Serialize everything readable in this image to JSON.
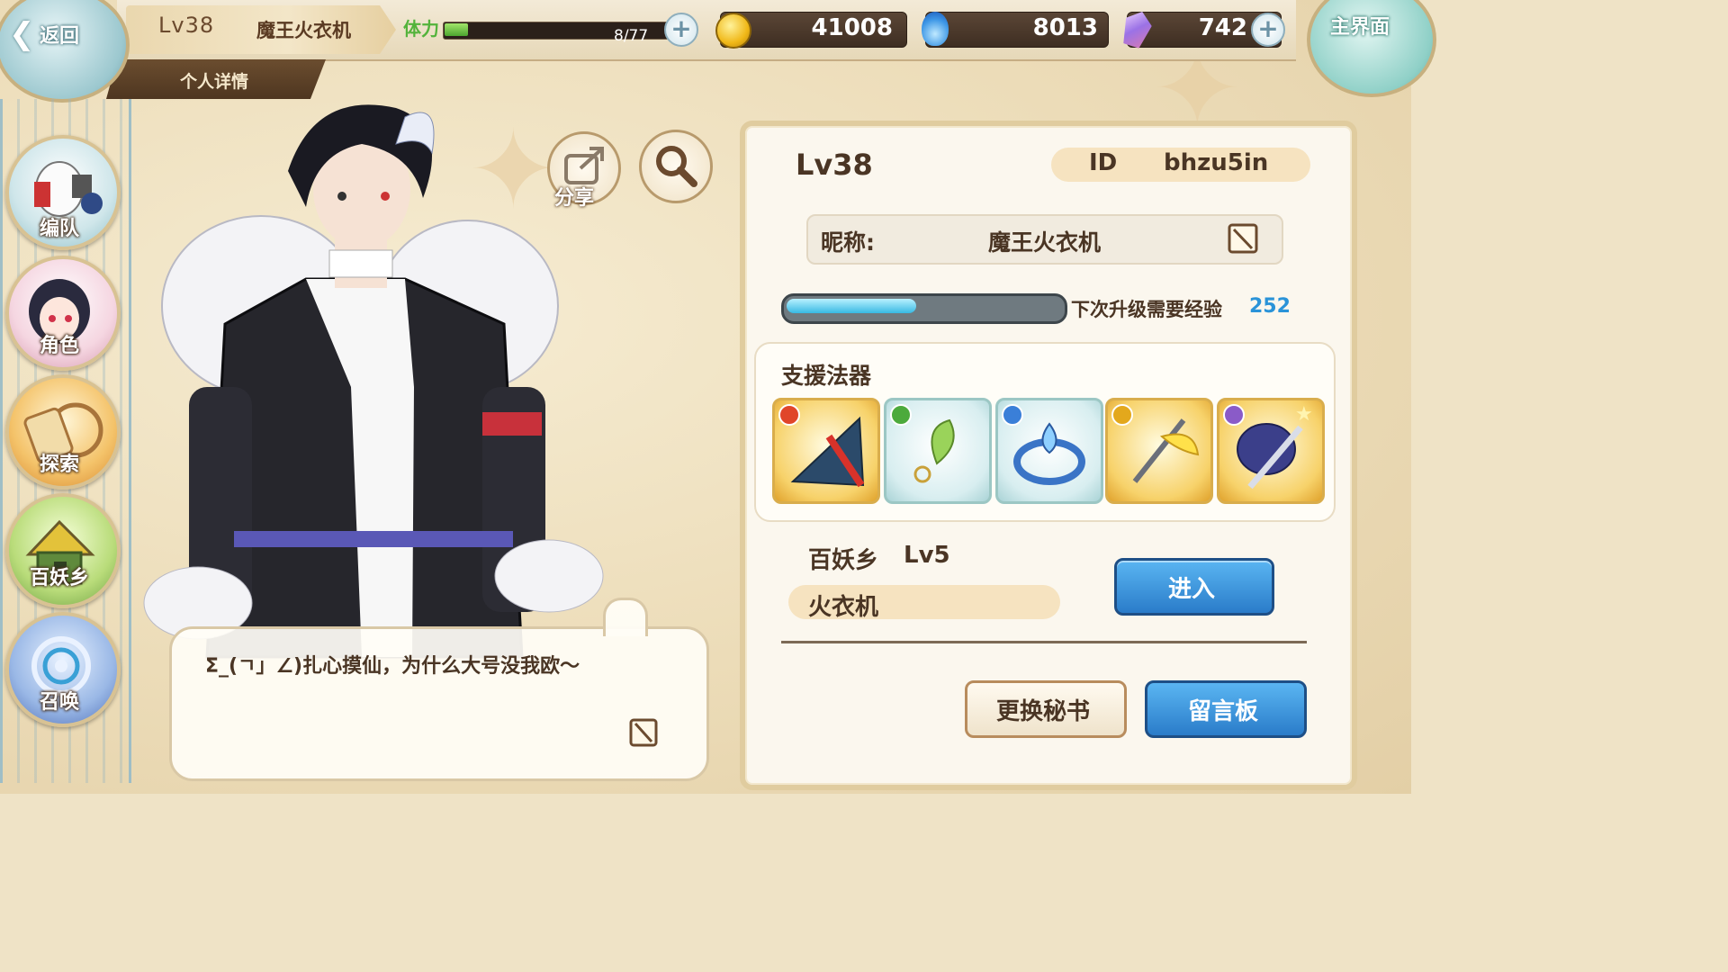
{
  "nav_top": {
    "back_label": "返回",
    "home_label": "主界面",
    "tab_label": "个人详情"
  },
  "player": {
    "level": "Lv38",
    "name": "魔王火衣机"
  },
  "resources": {
    "stamina_label": "体力",
    "stamina_text": "8/77",
    "stamina_fraction": 0.104,
    "gold": "41008",
    "soul_fire": "8013",
    "gems": "742"
  },
  "sidebar": {
    "items": [
      {
        "label": "编队",
        "icon": "formation-icon"
      },
      {
        "label": "角色",
        "icon": "character-icon"
      },
      {
        "label": "探索",
        "icon": "explore-icon"
      },
      {
        "label": "百妖乡",
        "icon": "village-icon"
      },
      {
        "label": "召唤",
        "icon": "summon-icon"
      }
    ]
  },
  "actions": {
    "share_label": "分享"
  },
  "speech": {
    "text": "Σ_(ㄱ」∠)扎心摸仙，为什么大号没我欧～"
  },
  "profile": {
    "level": "Lv38",
    "id_label": "ID",
    "id_value": "bhzu5in",
    "nickname_label": "昵称:",
    "nickname_value": "魔王火衣机",
    "exp_fraction": 0.48,
    "exp_label": "下次升级需要经验",
    "exp_value": "252",
    "support_title": "支援法器",
    "support_items": [
      {
        "icon": "fan-artifact-icon",
        "element_color": "#e0452a"
      },
      {
        "icon": "leaf-earring-artifact-icon",
        "element_color": "#4caa3c"
      },
      {
        "icon": "water-ring-artifact-icon",
        "element_color": "#3a7fd8"
      },
      {
        "icon": "golden-wing-sword-artifact-icon",
        "element_color": "#e3a81c"
      },
      {
        "icon": "dark-spirit-sword-artifact-icon",
        "element_color": "#8a5bc8"
      }
    ],
    "village_label": "百妖乡",
    "village_level": "Lv5",
    "village_owner": "火衣机",
    "enter_label": "进入",
    "change_secretary_label": "更换秘书",
    "message_board_label": "留言板"
  }
}
